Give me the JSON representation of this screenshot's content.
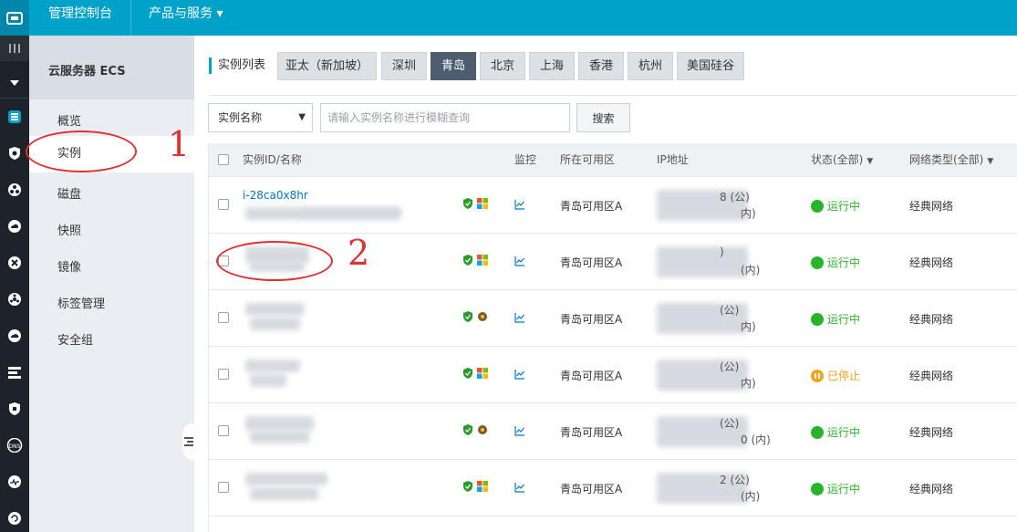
{
  "topbar": {
    "console": "管理控制台",
    "products": "产品与服务",
    "products_caret": "▾"
  },
  "sidebar": {
    "title": "云服务器 ECS",
    "items": [
      {
        "label": "概览"
      },
      {
        "label": "实例"
      },
      {
        "label": "磁盘"
      },
      {
        "label": "快照"
      },
      {
        "label": "镜像"
      },
      {
        "label": "标签管理"
      },
      {
        "label": "安全组"
      }
    ]
  },
  "annotations": {
    "one": "1",
    "two": "2",
    "color": "#e03030"
  },
  "list": {
    "title": "实例列表",
    "regions": [
      "亚太（新加坡）",
      "深圳",
      "青岛",
      "北京",
      "上海",
      "香港",
      "杭州",
      "美国硅谷"
    ],
    "active_region": "青岛"
  },
  "search": {
    "select_value": "实例名称",
    "placeholder": "请输入实例名称进行模糊查询",
    "button": "搜索"
  },
  "table": {
    "headers": {
      "id_name": "实例ID/名称",
      "monitor": "监控",
      "zone": "所在可用区",
      "ip": "IP地址",
      "status": "状态(全部)",
      "network": "网络类型(全部)"
    },
    "rows": [
      {
        "id": "i-28ca0x8hr",
        "zone": "青岛可用区A",
        "ip_public": "8 (公)",
        "ip_private": "内)",
        "status": "运行中",
        "state": "running",
        "network": "经典网络",
        "os": "windows"
      },
      {
        "id": "",
        "zone": "青岛可用区A",
        "ip_public": ")",
        "ip_private": "(内)",
        "status": "运行中",
        "state": "running",
        "network": "经典网络",
        "os": "windows"
      },
      {
        "id": "",
        "zone": "青岛可用区A",
        "ip_public": "(公)",
        "ip_private": "内)",
        "status": "运行中",
        "state": "running",
        "network": "经典网络",
        "os": "linux"
      },
      {
        "id": "",
        "zone": "青岛可用区A",
        "ip_public": "(公)",
        "ip_private": "内)",
        "status": "已停止",
        "state": "stopped",
        "network": "经典网络",
        "os": "windows"
      },
      {
        "id": "",
        "zone": "青岛可用区A",
        "ip_public": "(公)",
        "ip_private": "0 (内)",
        "status": "运行中",
        "state": "running",
        "network": "经典网络",
        "os": "linux"
      },
      {
        "id": "",
        "zone": "青岛可用区A",
        "ip_public": "2 (公)",
        "ip_private": "(内)",
        "status": "运行中",
        "state": "running",
        "network": "经典网络",
        "os": "windows"
      }
    ]
  },
  "colors": {
    "topbar": "#00a2ca",
    "running": "#29b52b",
    "stopped": "#f4a21e",
    "link": "#0077c8"
  }
}
